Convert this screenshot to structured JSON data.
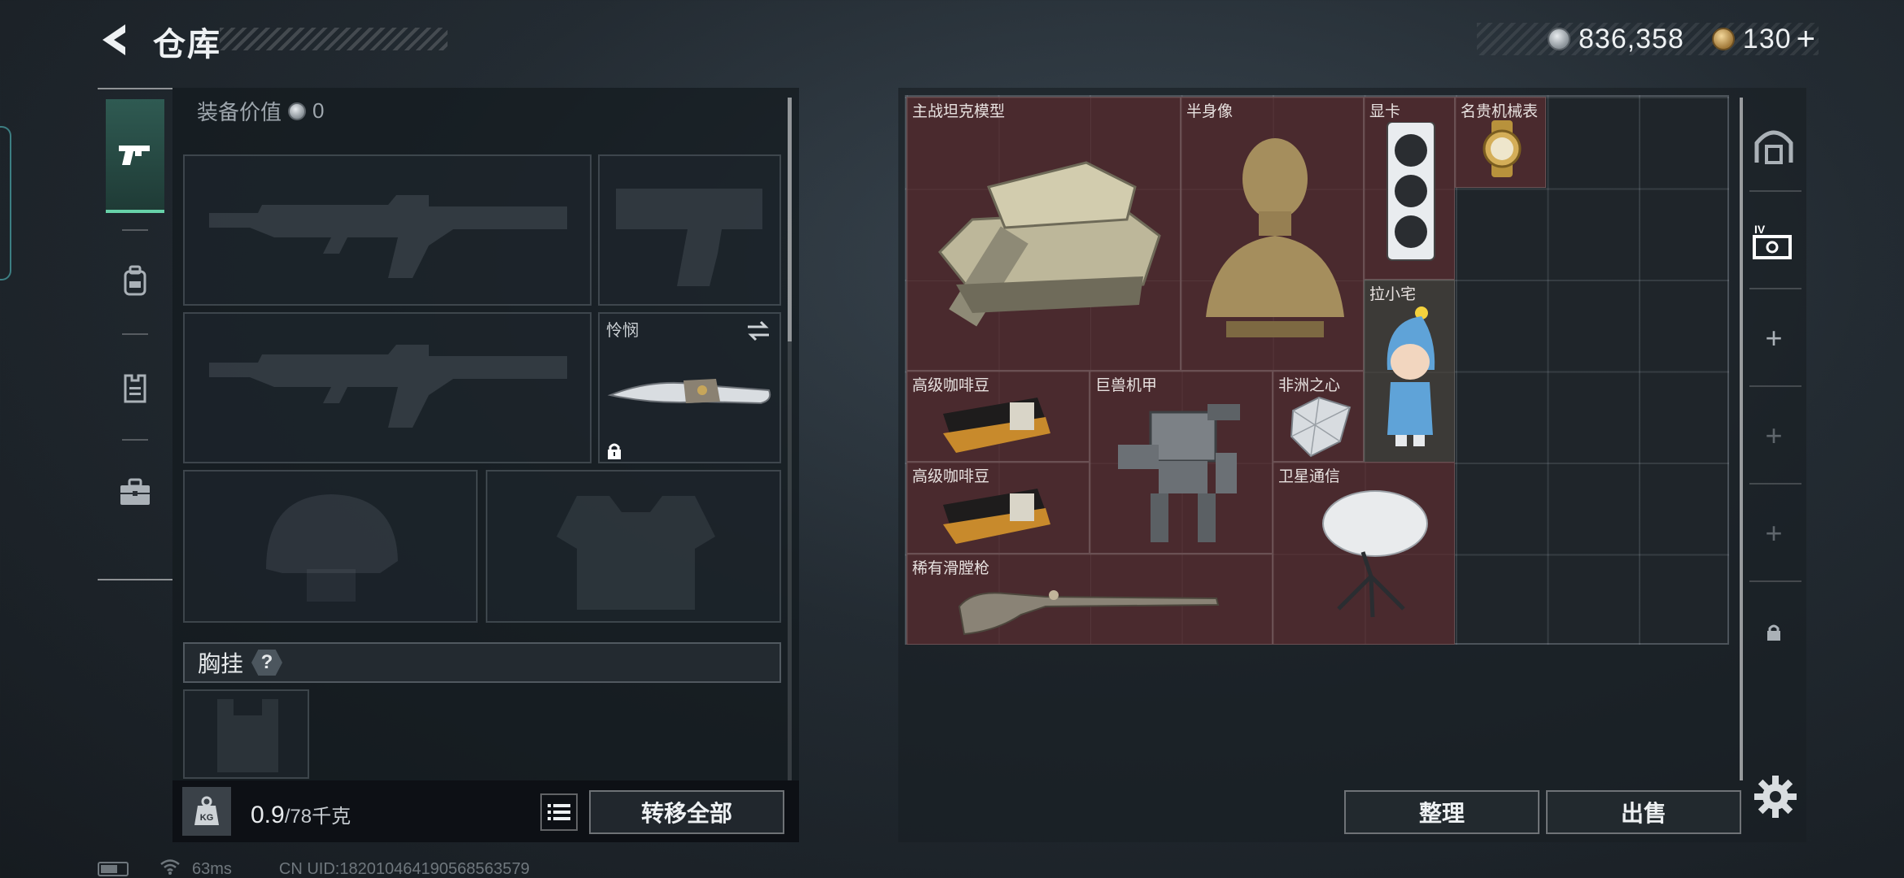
{
  "header": {
    "title": "仓库",
    "currency_silver": "836,358",
    "currency_gold": "130",
    "currency_plus": "+"
  },
  "equipment": {
    "value_label": "装备价值",
    "value": "0",
    "melee_slot_label": "怜悯",
    "chest_rig_label": "胸挂",
    "chest_rig_help": "?"
  },
  "weight": {
    "current": "0.9",
    "max": "/78千克",
    "icon_label": "KG"
  },
  "buttons": {
    "transfer_all": "转移全部",
    "sort": "整理",
    "sell": "出售"
  },
  "storage_items": [
    {
      "label": "主战坦克模型"
    },
    {
      "label": "半身像"
    },
    {
      "label": "显卡"
    },
    {
      "label": "名贵机械表"
    },
    {
      "label": "拉小宅"
    },
    {
      "label": "高级咖啡豆"
    },
    {
      "label": "巨兽机甲"
    },
    {
      "label": "非洲之心"
    },
    {
      "label": "高级咖啡豆"
    },
    {
      "label": "卫星通信"
    },
    {
      "label": "稀有滑膛枪"
    }
  ],
  "status": {
    "ping": "63ms",
    "uid": "CN UID:182010464190568563579"
  },
  "colors": {
    "item_bg": "#4a2a2e",
    "active_nav": "#67d1a9"
  }
}
